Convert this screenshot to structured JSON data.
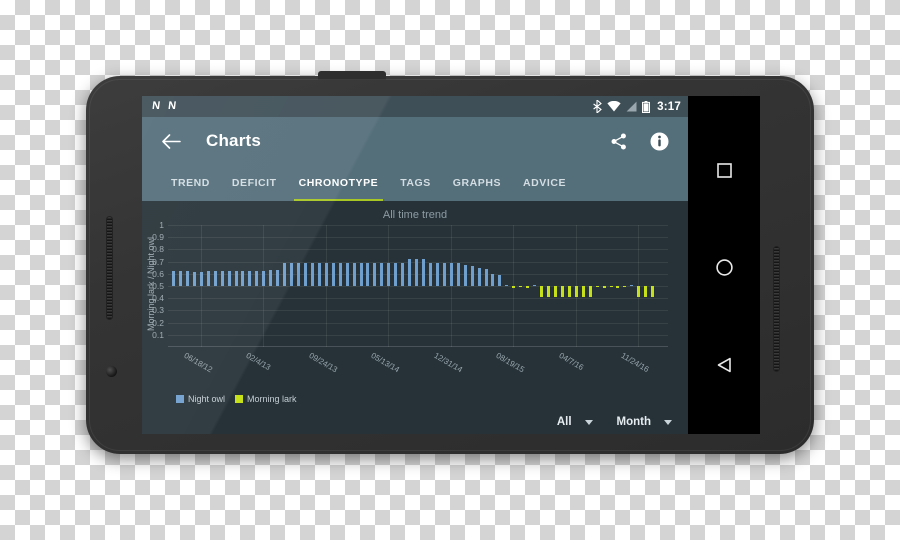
{
  "statusbar": {
    "notifications": [
      "N",
      "N"
    ],
    "icons": [
      "bluetooth-icon",
      "wifi-icon",
      "cellular-signal-icon",
      "battery-icon"
    ],
    "clock": "3:17"
  },
  "appbar": {
    "back_label": "back-arrow",
    "title": "Charts",
    "actions": [
      {
        "name": "share-button",
        "label": "share-icon"
      },
      {
        "name": "info-button",
        "label": "info-icon"
      }
    ]
  },
  "tabs": [
    {
      "label": "TREND",
      "active": false
    },
    {
      "label": "DEFICIT",
      "active": false
    },
    {
      "label": "CHRONOTYPE",
      "active": true
    },
    {
      "label": "TAGS",
      "active": false
    },
    {
      "label": "GRAPHS",
      "active": false
    },
    {
      "label": "ADVICE",
      "active": false
    }
  ],
  "legend": [
    {
      "label": "Night owl",
      "color": "#6f9fcd"
    },
    {
      "label": "Morning lark",
      "color": "#c6e01a"
    }
  ],
  "selectors": [
    {
      "name": "range-selector",
      "value": "All"
    },
    {
      "name": "grouping-selector",
      "value": "Month"
    }
  ],
  "navbar": [
    {
      "name": "recents-button",
      "glyph": "square"
    },
    {
      "name": "home-button",
      "glyph": "circle"
    },
    {
      "name": "back-button",
      "glyph": "triangle"
    }
  ],
  "colors": {
    "accent": "#a8c725",
    "appbar": "#546e7a",
    "statusbar": "#3f4f57",
    "canvas": "#263238",
    "night_owl": "#6f9fcd",
    "morning_lark": "#c6e01a"
  },
  "chart_data": {
    "type": "bar",
    "title": "All time trend",
    "xlabel": "",
    "ylabel": "Morning lark / Night owl",
    "ylim": [
      0,
      1
    ],
    "baseline": 0.5,
    "grid": true,
    "legend_position": "bottom-left",
    "yticks": [
      1,
      0.9,
      0.8,
      0.7,
      0.6,
      0.5,
      0.4,
      0.3,
      0.2,
      0.1
    ],
    "xtick_labels": [
      "06/18/12",
      "02/4/13",
      "09/24/13",
      "05/13/14",
      "12/31/14",
      "08/19/15",
      "04/7/16",
      "11/24/16"
    ],
    "xtick_positions": [
      0.065,
      0.19,
      0.315,
      0.44,
      0.565,
      0.69,
      0.815,
      0.94
    ],
    "series": [
      {
        "name": "Night owl",
        "color": "#6f9fcd",
        "direction": "up"
      },
      {
        "name": "Morning lark",
        "color": "#c6e01a",
        "direction": "down"
      }
    ],
    "values": [
      0.62,
      0.62,
      0.62,
      0.615,
      0.615,
      0.62,
      0.62,
      0.62,
      0.625,
      0.625,
      0.625,
      0.625,
      0.625,
      0.625,
      0.63,
      0.63,
      0.685,
      0.685,
      0.685,
      0.685,
      0.69,
      0.685,
      0.685,
      0.69,
      0.685,
      0.685,
      0.685,
      0.69,
      0.685,
      0.685,
      0.685,
      0.69,
      0.69,
      0.69,
      0.72,
      0.725,
      0.725,
      0.69,
      0.69,
      0.685,
      0.685,
      0.685,
      0.67,
      0.665,
      0.645,
      0.64,
      0.595,
      0.59,
      0.51,
      0.485,
      0.49,
      0.485,
      0.51,
      0.41,
      0.41,
      0.41,
      0.41,
      0.41,
      0.41,
      0.41,
      0.41,
      0.49,
      0.485,
      0.49,
      0.485,
      0.49,
      0.51,
      0.41,
      0.41,
      0.41
    ]
  }
}
